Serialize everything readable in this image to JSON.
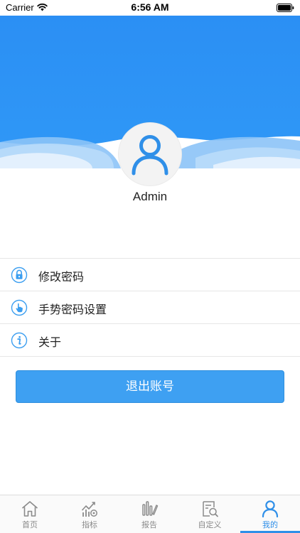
{
  "status_bar": {
    "carrier": "Carrier",
    "time": "6:56 AM",
    "wifi_icon": "wifi-icon",
    "battery_icon": "battery-full-icon"
  },
  "profile": {
    "avatar_icon": "user-icon",
    "username": "Admin"
  },
  "menu": {
    "items": [
      {
        "icon": "lock-icon",
        "label": "修改密码"
      },
      {
        "icon": "gesture-hand-icon",
        "label": "手势密码设置"
      },
      {
        "icon": "info-icon",
        "label": "关于"
      }
    ]
  },
  "logout": {
    "label": "退出账号"
  },
  "tab_bar": {
    "tabs": [
      {
        "icon": "home-icon",
        "label": "首页"
      },
      {
        "icon": "indicator-chart-icon",
        "label": "指标"
      },
      {
        "icon": "report-icon",
        "label": "报告"
      },
      {
        "icon": "custom-search-icon",
        "label": "自定义"
      },
      {
        "icon": "user-icon",
        "label": "我的"
      }
    ],
    "active_index": 4
  },
  "colors": {
    "header_blue": "#2f93f5",
    "accent": "#2f8fe8",
    "button": "#3ea0f2",
    "tab_inactive": "#8a8a8a"
  }
}
